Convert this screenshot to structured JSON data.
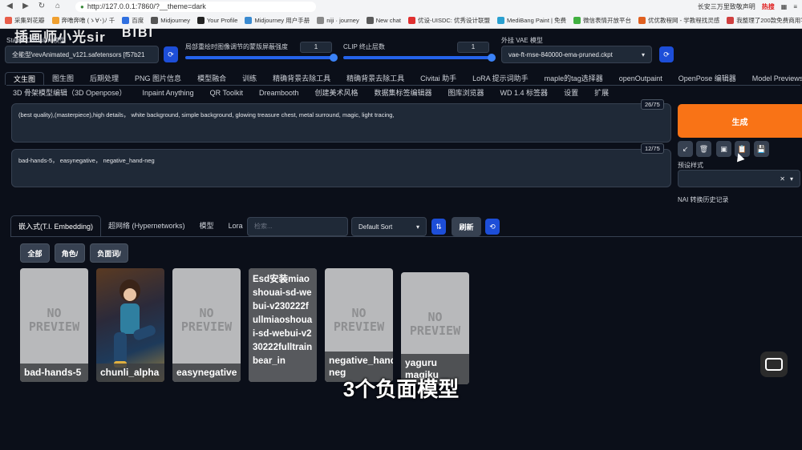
{
  "browser": {
    "url": "http://127.0.0.1:7860/?__theme=dark",
    "right_text": "长安三万里致敬声明",
    "hot": "热搜",
    "bookmarks": [
      "采集到花瓣",
      "奔噜奔噜 (ゝ∀･)ﾉ 千",
      "百度",
      "Midjourney",
      "Your Profile",
      "Midjourney 用户手册",
      "niji · journey",
      "New chat",
      "优设-UISDC: 优秀设计联盟",
      "MediBang Paint | 免费",
      "微信表情开放平台",
      "优优教程网 - 学教程找灵感",
      "我整理了200款免费商用字"
    ]
  },
  "watermark": {
    "left": "插画师小光sir",
    "right": "BIBI"
  },
  "top": {
    "sd_model_label": "Stable Diffusion 模型",
    "sd_model_value": "全能型\\revAnimated_v121.safetensors [f57b21",
    "mask_label": "局部重绘时图像调节的蒙版屏蔽强度",
    "mask_value": "1",
    "clip_label": "CLIP 终止层数",
    "clip_value": "1",
    "vae_label": "外挂 VAE 模型",
    "vae_value": "vae-ft-mse-840000-ema-pruned.ckpt"
  },
  "tabs_row1": [
    "文生图",
    "图生图",
    "后期处理",
    "PNG 图片信息",
    "模型融合",
    "训练",
    "精确背景去除工具",
    "精确背景去除工具",
    "Civitai 助手",
    "LoRA 提示词助手",
    "maple的tag选择器",
    "openOutpaint",
    "OpenPose 编辑器",
    "Model Previews"
  ],
  "tabs_row2": [
    "3D 骨架模型编辑（3D Openpose）",
    "Inpaint Anything",
    "QR Toolkit",
    "Dreambooth",
    "创建美术风格",
    "数据集标签编辑器",
    "图库浏览器",
    "WD 1.4 标签器",
    "设置",
    "扩展"
  ],
  "prompt": {
    "positive": "(best quality),(masterpiece),high details， white background, simple background, glowing treasure chest, metal surround, magic, light tracing,",
    "positive_count": "26/75",
    "negative": "bad-hands-5， easynegative， negative_hand-neg",
    "negative_count": "12/75"
  },
  "right": {
    "generate": "生成",
    "tools": [
      "↙",
      "🗑",
      "▣",
      "📋",
      "💾"
    ],
    "preset_label": "预设样式",
    "history": "NAI 转换历史记录"
  },
  "network": {
    "subtabs": [
      "嵌入式(T.I. Embedding)",
      "超网络 (Hypernetworks)",
      "模型",
      "Lora"
    ],
    "search_placeholder": "检索...",
    "sort": "Default Sort",
    "refresh": "刷新",
    "filters": [
      "全部",
      "角色/",
      "负面词/"
    ],
    "cards": [
      {
        "name": "bad-hands-5",
        "preview": "NO PREVIEW"
      },
      {
        "name": "chunli_alpha",
        "preview": ""
      },
      {
        "name": "easynegative",
        "preview": "NO PREVIEW"
      },
      {
        "name": "Esd安装miaoshouai-sd-webui-v230222fullmiaoshouai-sd-webui-v230222fulltrainbear_in",
        "preview": ""
      },
      {
        "name": "negative_hand-neg",
        "preview": "NO PREVIEW"
      },
      {
        "name": "yaguru magiku",
        "preview": "NO PREVIEW"
      }
    ]
  },
  "subtitle": "3个负面模型"
}
